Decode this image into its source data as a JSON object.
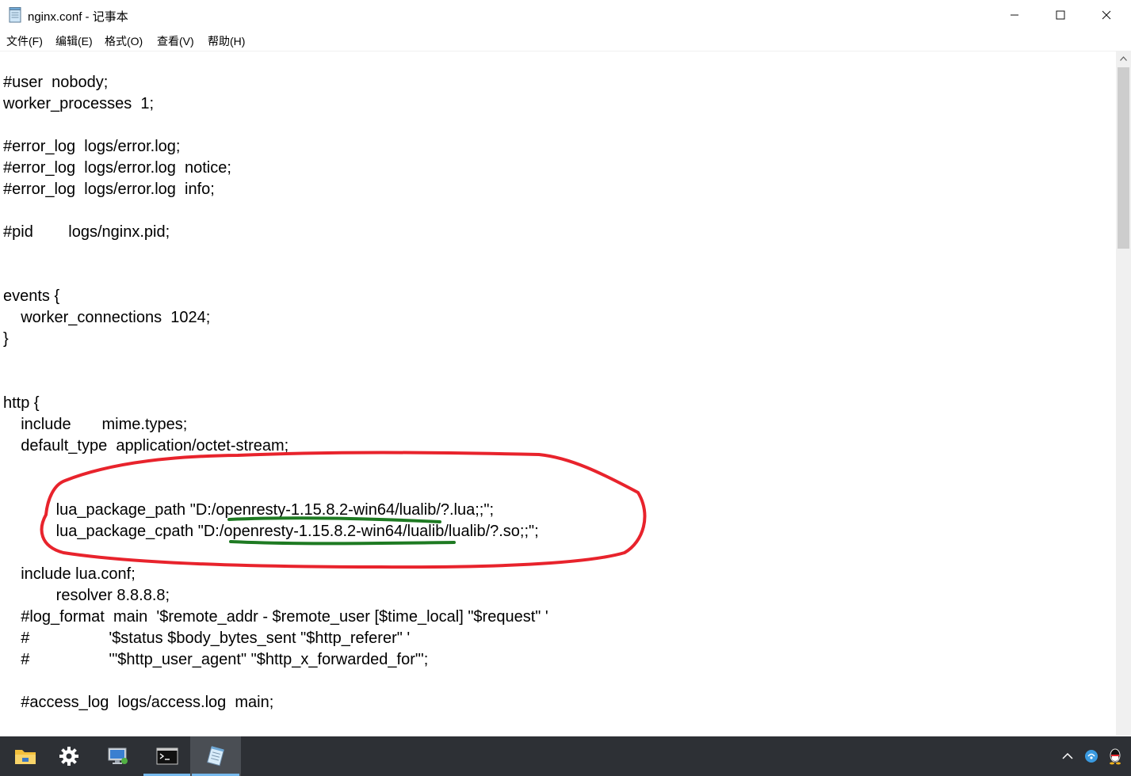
{
  "window": {
    "title": "nginx.conf - 记事本",
    "controls": {
      "minimize": "—",
      "maximize": "☐",
      "close": "✕"
    }
  },
  "menu": [
    "文件(F)",
    "编辑(E)",
    "格式(O)",
    "查看(V)",
    "帮助(H)"
  ],
  "editor": {
    "lines": [
      "#user  nobody;",
      "worker_processes  1;",
      "",
      "#error_log  logs/error.log;",
      "#error_log  logs/error.log  notice;",
      "#error_log  logs/error.log  info;",
      "",
      "#pid        logs/nginx.pid;",
      "",
      "",
      "events {",
      "    worker_connections  1024;",
      "}",
      "",
      "",
      "http {",
      "    include       mime.types;",
      "    default_type  application/octet-stream;",
      "",
      "",
      "            lua_package_path \"D:/openresty-1.15.8.2-win64/lualib/?.lua;;\";",
      "            lua_package_cpath \"D:/openresty-1.15.8.2-win64/lualib/lualib/?.so;;\";",
      "",
      "    include lua.conf;",
      "            resolver 8.8.8.8;",
      "    #log_format  main  '$remote_addr - $remote_user [$time_local] \"$request\" '",
      "    #                  '$status $body_bytes_sent \"$http_referer\" '",
      "    #                  '\"$http_user_agent\" \"$http_x_forwarded_for\"';",
      "",
      "    #access_log  logs/access.log  main;"
    ]
  },
  "annotation_colors": {
    "circle": "#e8232c",
    "underline": "#1e7a22"
  },
  "taskbar": {
    "apps": [
      "file-explorer",
      "settings",
      "remote-desktop",
      "command-prompt",
      "notepad"
    ],
    "active": "notepad",
    "tray": [
      "chevron-up",
      "network",
      "qq"
    ]
  }
}
